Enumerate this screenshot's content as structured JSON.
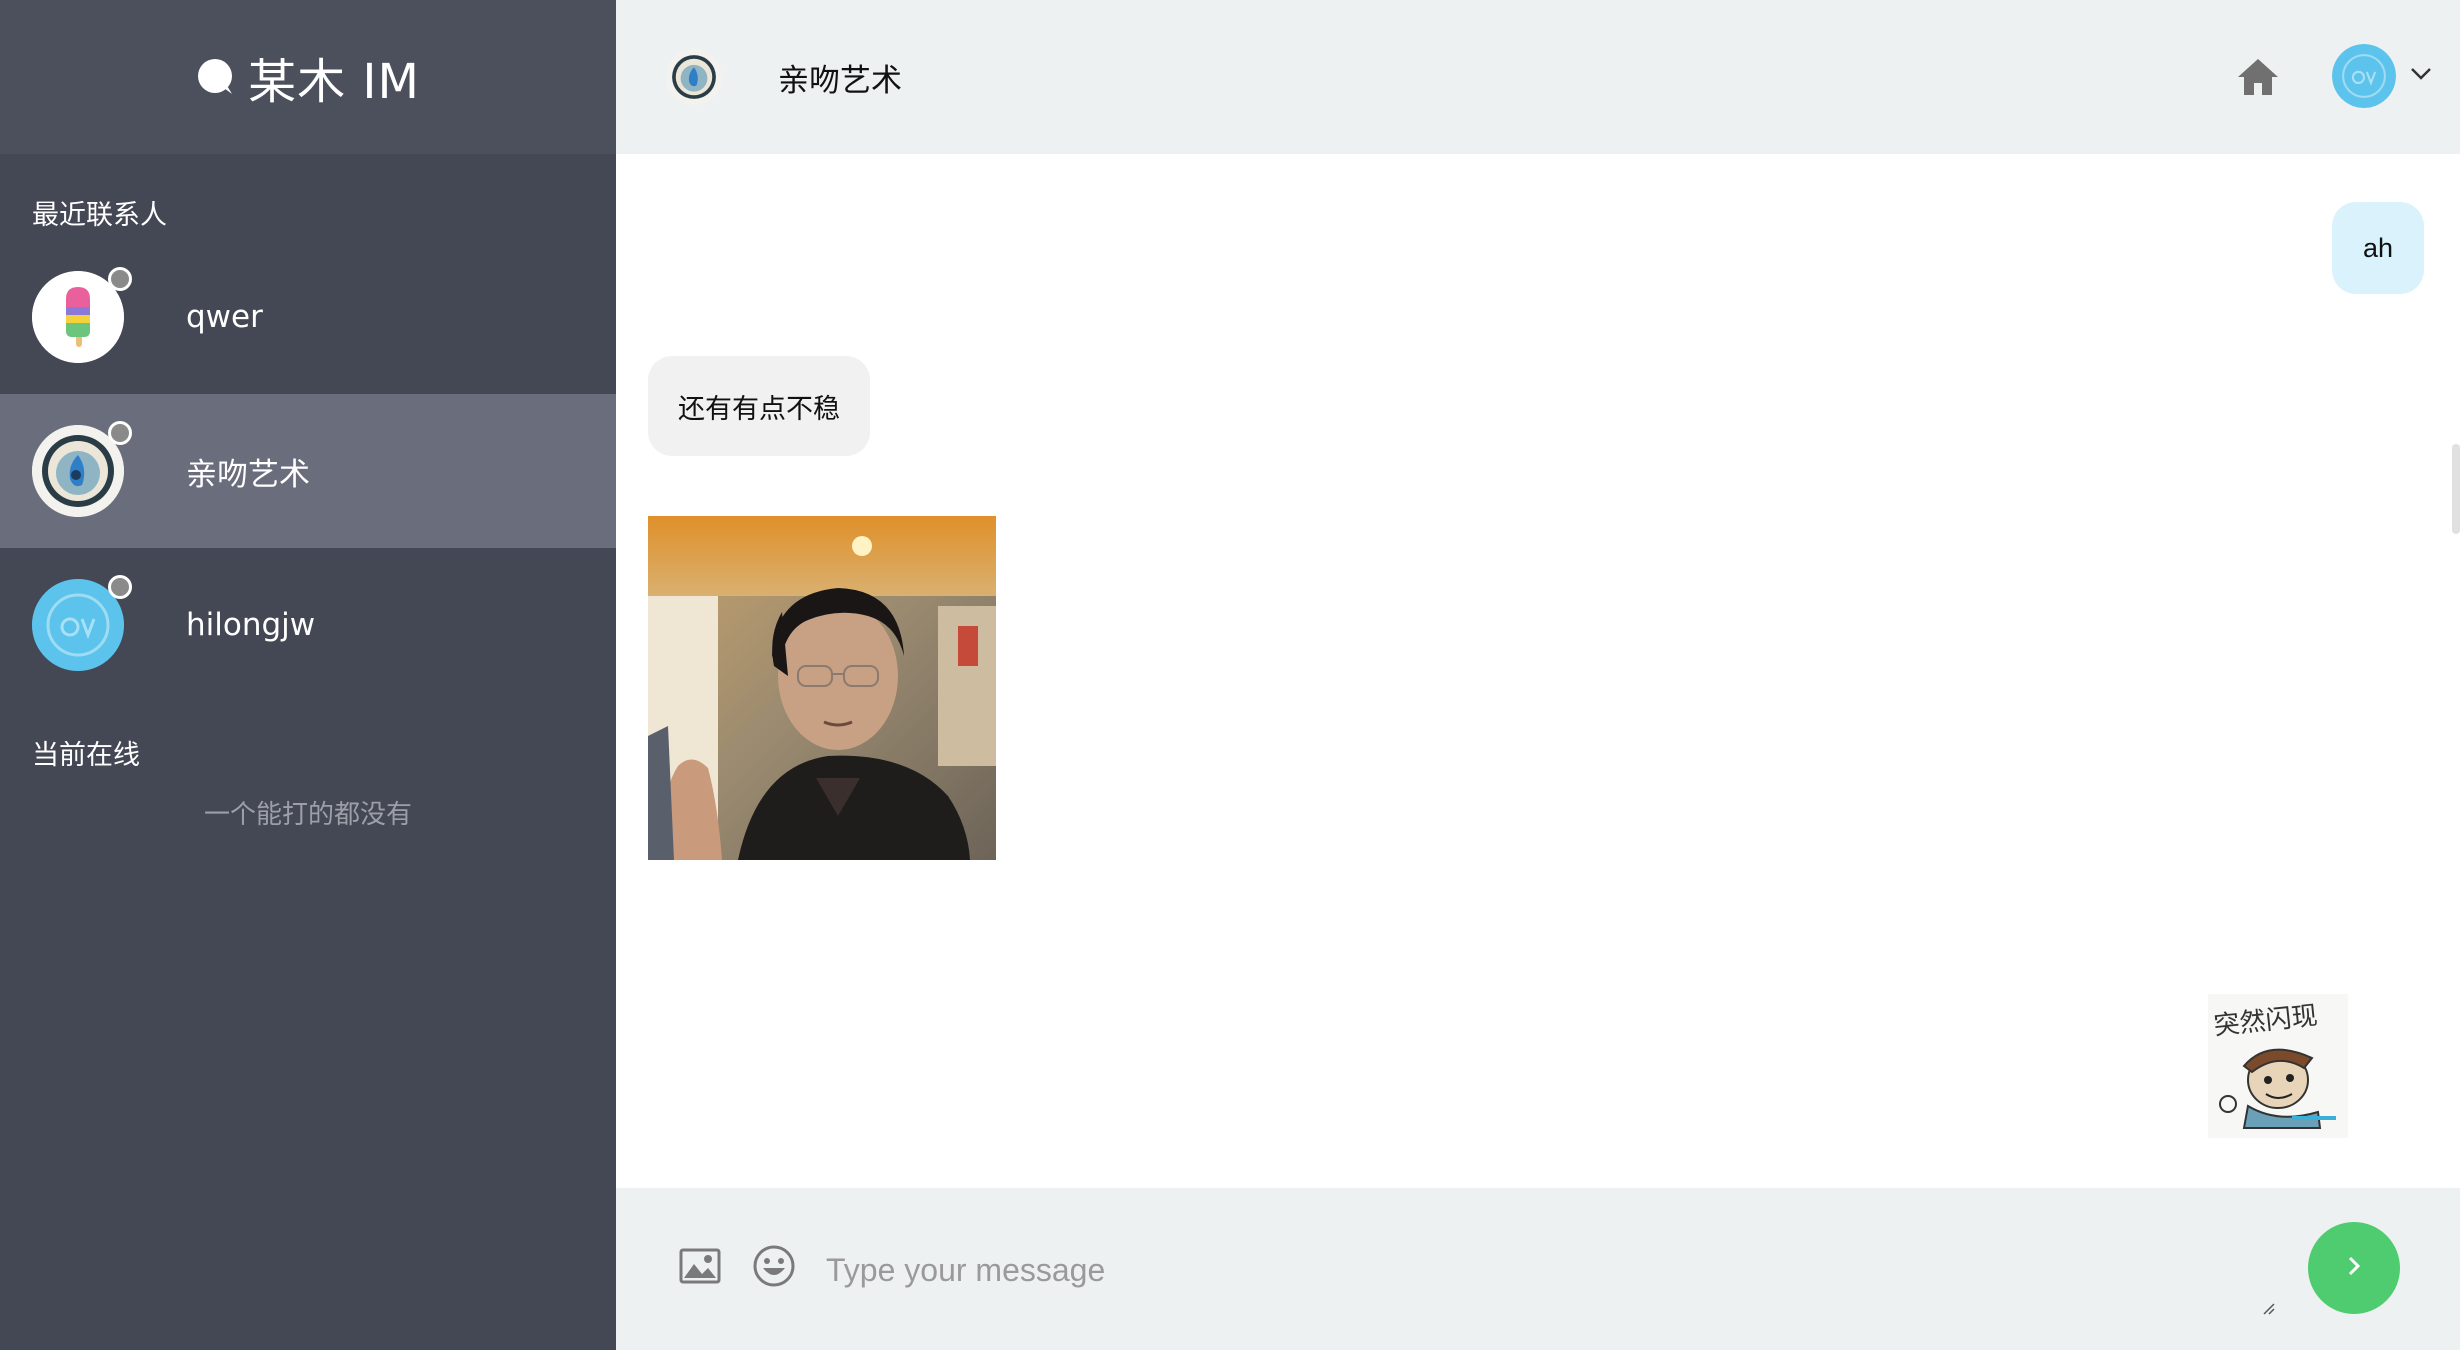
{
  "app": {
    "brand_name": "某木 IM",
    "brand_icon": "chat-bubble-icon"
  },
  "sidebar": {
    "recent_title": "最近联系人",
    "contacts": [
      {
        "name": "qwer",
        "avatar": "popsicle-avatar",
        "status": "offline"
      },
      {
        "name": "亲吻艺术",
        "avatar": "abstract-art-avatar",
        "status": "offline",
        "active": true
      },
      {
        "name": "hilongjw",
        "avatar": "ov-logo-avatar",
        "status": "offline"
      }
    ],
    "online_title": "当前在线",
    "online_empty": "一个能打的都没有"
  },
  "header": {
    "title": "亲吻艺术",
    "home_icon": "home-icon",
    "user_menu_icon": "chevron-down-icon"
  },
  "messages": [
    {
      "direction": "out",
      "type": "text",
      "text": "ah"
    },
    {
      "direction": "in",
      "type": "text",
      "text": "还有有点不稳"
    },
    {
      "direction": "in",
      "type": "image",
      "content": "photo of man waving"
    },
    {
      "direction": "out",
      "type": "image",
      "content": "cartoon sticker 突然闪现"
    }
  ],
  "composer": {
    "placeholder": "Type your message",
    "value": "",
    "image_icon": "image-icon",
    "emoji_icon": "smiley-icon",
    "send_icon": "chevron-right-icon"
  },
  "colors": {
    "sidebar_bg": "#444754",
    "sidebar_active": "#6a6d7b",
    "header_bg": "#eef1f2",
    "bubble_out": "#daf2fb",
    "bubble_in": "#f1f1f1",
    "send_button": "#4fcc6f"
  }
}
